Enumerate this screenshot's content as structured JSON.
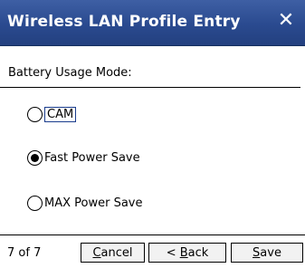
{
  "window": {
    "title": "Wireless LAN Profile Entry",
    "close_symbol": "✕"
  },
  "form": {
    "section_label": "Battery Usage Mode:",
    "options": [
      {
        "label": "CAM",
        "selected": false,
        "focused": true
      },
      {
        "label": "Fast Power Save",
        "selected": true,
        "focused": false
      },
      {
        "label": "MAX Power Save",
        "selected": false,
        "focused": false
      }
    ]
  },
  "footer": {
    "page_count": "7 of 7",
    "cancel": {
      "mnemonic": "C",
      "rest": "ancel"
    },
    "back": {
      "prefix": "< ",
      "mnemonic": "B",
      "rest": "ack"
    },
    "save": {
      "mnemonic": "S",
      "rest": "ave"
    }
  }
}
